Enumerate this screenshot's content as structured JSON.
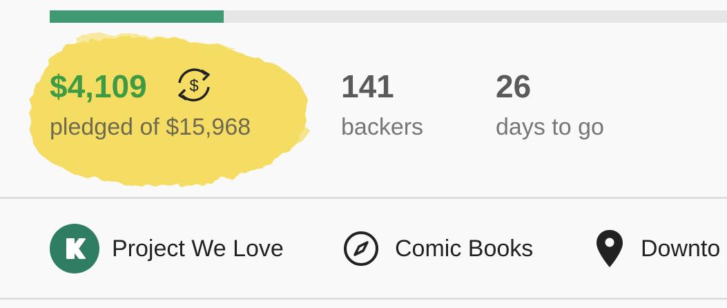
{
  "campaign": {
    "progress_percent": 25.7,
    "colors": {
      "accent": "#3f9972",
      "pledged_value": "#3e9b43",
      "highlight": "#f5d94a"
    },
    "stats": {
      "pledged_value": "$4,109",
      "pledged_label": "pledged of $15,968",
      "currency_icon": "currency-conversion-icon",
      "backers_value": "141",
      "backers_label": "backers",
      "days_value": "26",
      "days_label": "days to go"
    },
    "tags": [
      {
        "label": "Project We Love",
        "icon": "kickstarter-k-icon"
      },
      {
        "label": "Comic Books",
        "icon": "compass-icon"
      },
      {
        "label": "Downto",
        "icon": "location-pin-icon"
      }
    ]
  }
}
